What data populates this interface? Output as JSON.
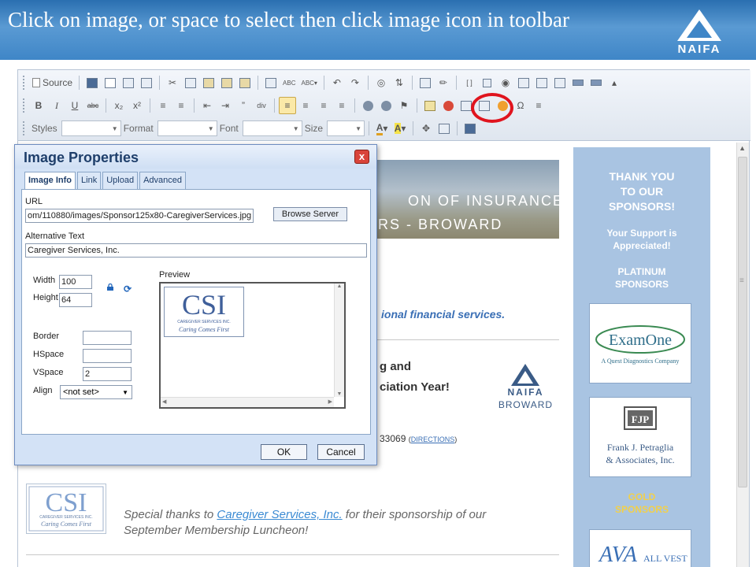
{
  "slide": {
    "title": "Click  on image, or space to select then click image icon in toolbar",
    "logo_text": "NAIFA"
  },
  "toolbar": {
    "row1": {
      "source_label": "Source"
    },
    "row3": {
      "styles_label": "Styles",
      "format_label": "Format",
      "font_label": "Font",
      "size_label": "Size"
    },
    "annotation_color": "#e0141e"
  },
  "content": {
    "banner": {
      "line1": "ON OF INSURANCE",
      "line2": "RS - BROWARD"
    },
    "tagline": "ional financial services.",
    "event_line1": "g and",
    "event_line2": "ciation Year!",
    "naifa_broward": {
      "name": "NAIFA",
      "chapter": "BROWARD"
    },
    "zip": "33069",
    "directions": "DIRECTIONS",
    "thanks": {
      "before": "Special thanks to ",
      "link": "Caregiver Services, Inc.",
      "after": " for their sponsorship of our September Membership Luncheon!"
    },
    "csi_logo": {
      "letters": "CSI",
      "line1": "CAREGIVER SERVICES INC.",
      "line2": "Caring Comes First"
    }
  },
  "sponsors": {
    "thank_you": "THANK YOU TO OUR SPONSORS!",
    "support": "Your Support is Appreciated!",
    "platinum": "PLATINUM SPONSORS",
    "examone": {
      "name": "ExamOne",
      "sub": "A Quest Diagnostics Company"
    },
    "fjp": {
      "initials": "FJP",
      "line1": "Frank J. Petraglia",
      "line2": "& Associates, Inc."
    },
    "gold": "GOLD SPONSORS",
    "allvest": {
      "mark": "AVA",
      "name": "ALL VEST"
    }
  },
  "dialog": {
    "title": "Image Properties",
    "close": "x",
    "tabs": [
      "Image Info",
      "Link",
      "Upload",
      "Advanced"
    ],
    "url_label": "URL",
    "url_value": "om/110880/images/Sponsor125x80-CaregiverServices.jpg",
    "browse_button": "Browse Server",
    "alt_label": "Alternative Text",
    "alt_value": "Caregiver Services, Inc.",
    "width_label": "Width",
    "width_value": "100",
    "height_label": "Height",
    "height_value": "64",
    "preview_label": "Preview",
    "border_label": "Border",
    "border_value": "",
    "hspace_label": "HSpace",
    "hspace_value": "",
    "vspace_label": "VSpace",
    "vspace_value": "2",
    "align_label": "Align",
    "align_value": "<not set>",
    "ok_button": "OK",
    "cancel_button": "Cancel"
  }
}
